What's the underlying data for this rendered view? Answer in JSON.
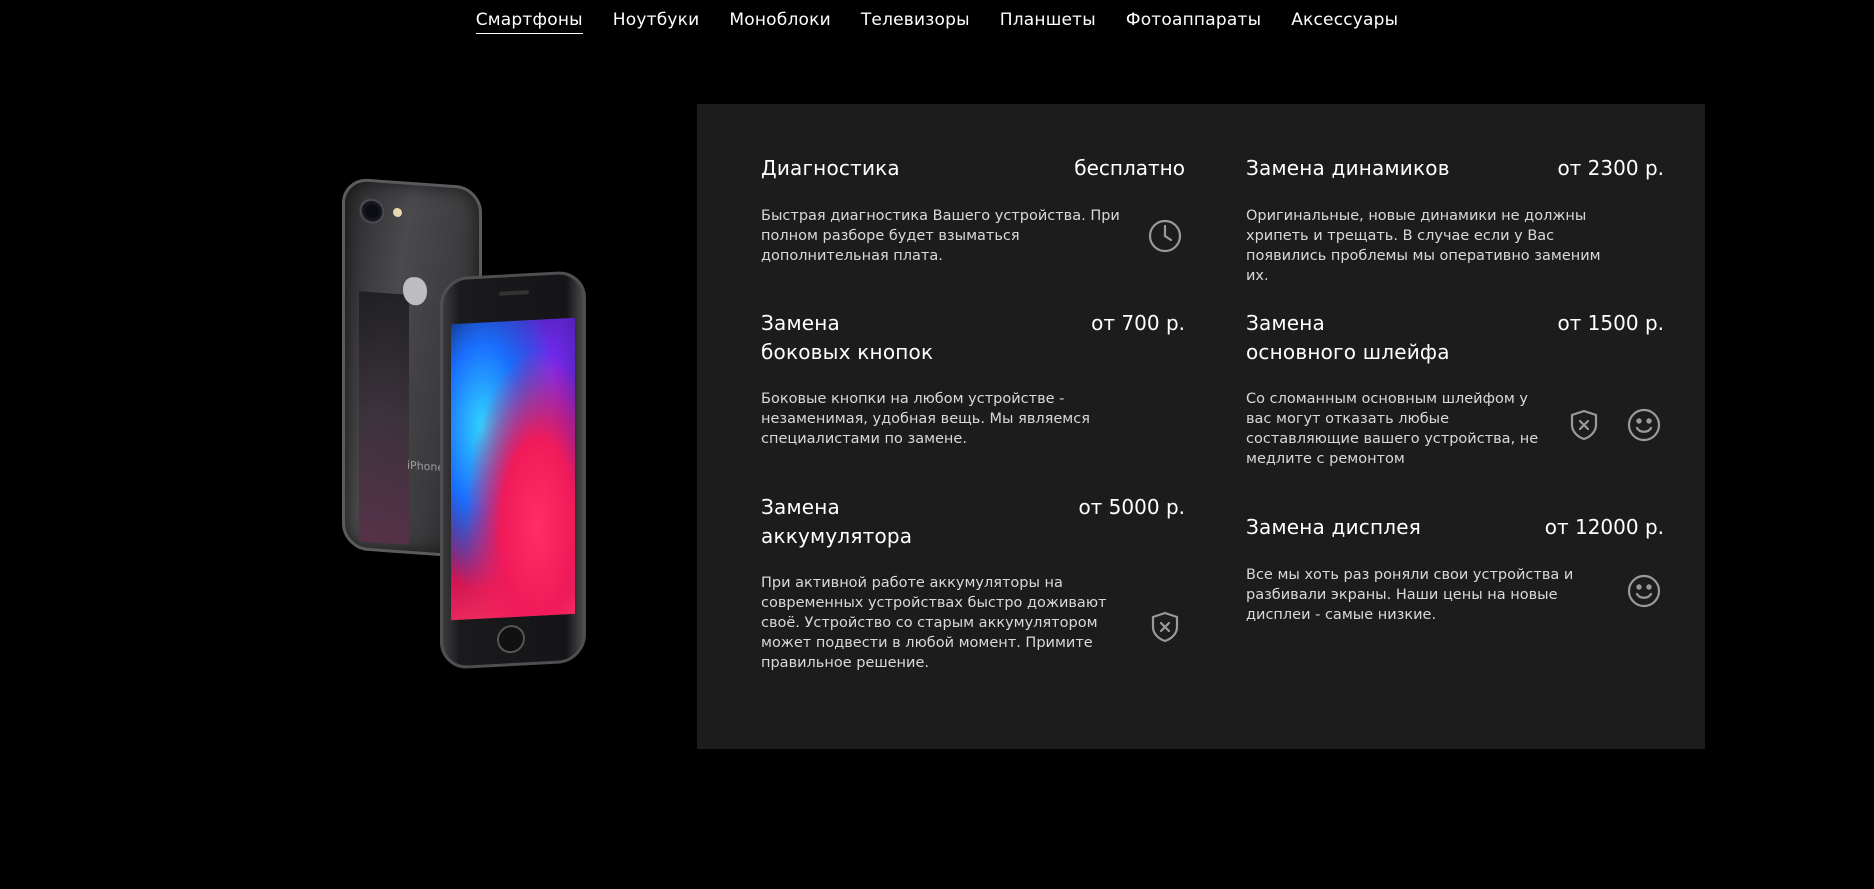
{
  "nav": {
    "items": [
      {
        "label": "Смартфоны",
        "active": true
      },
      {
        "label": "Ноутбуки",
        "active": false
      },
      {
        "label": "Моноблоки",
        "active": false
      },
      {
        "label": "Телевизоры",
        "active": false
      },
      {
        "label": "Планшеты",
        "active": false
      },
      {
        "label": "Фотоаппараты",
        "active": false
      },
      {
        "label": "Аксессуары",
        "active": false
      }
    ]
  },
  "product_image": {
    "back_label": "iPhone"
  },
  "colors": {
    "background": "#000000",
    "panel": "#1c1c1c",
    "text": "#ffffff",
    "muted_text": "#d9d9d9",
    "icon": "#9a9a9a"
  },
  "services": {
    "diagnostics": {
      "title": "Диагностика",
      "price": "бесплатно",
      "description": "Быстрая диагностика Вашего устройства. При полном разборе будет взыматься дополнительная плата.",
      "icons": [
        "clock-icon"
      ]
    },
    "side_buttons": {
      "title_line1": "Замена",
      "title_line2": "боковых кнопок",
      "price": "от 700 р.",
      "description": "Боковые кнопки на любом устройстве - незаменимая, удобная вещь. Мы являемся специалистами по замене.",
      "icons": []
    },
    "battery": {
      "title_line1": "Замена",
      "title_line2": "аккумулятора",
      "price": "от 5000 р.",
      "description": "При активной работе аккумуляторы на современных устройствах быстро доживают своё. Устройство со старым аккумулятором может подвести в любой момент. Примите правильное решение.",
      "icons": [
        "shield-x-icon"
      ]
    },
    "speakers": {
      "title": "Замена динамиков",
      "price": "от 2300 р.",
      "description": "Оригинальные, новые динамики не должны хрипеть и трещать. В случае если у Вас появились проблемы мы оперативно заменим их.",
      "icons": []
    },
    "main_cable": {
      "title_line1": "Замена",
      "title_line2": "основного шлейфа",
      "price": "от 1500 р.",
      "description": "Со сломанным основным шлейфом у вас могут отказать любые составляющие вашего устройства, не медлите с ремонтом",
      "icons": [
        "shield-x-icon",
        "smile-icon"
      ]
    },
    "display": {
      "title": "Замена дисплея",
      "price": "от 12000 р.",
      "description": "Все мы хоть раз роняли свои устройства и разбивали экраны. Наши цены на новые дисплеи - самые низкие.",
      "icons": [
        "smile-icon"
      ]
    }
  }
}
